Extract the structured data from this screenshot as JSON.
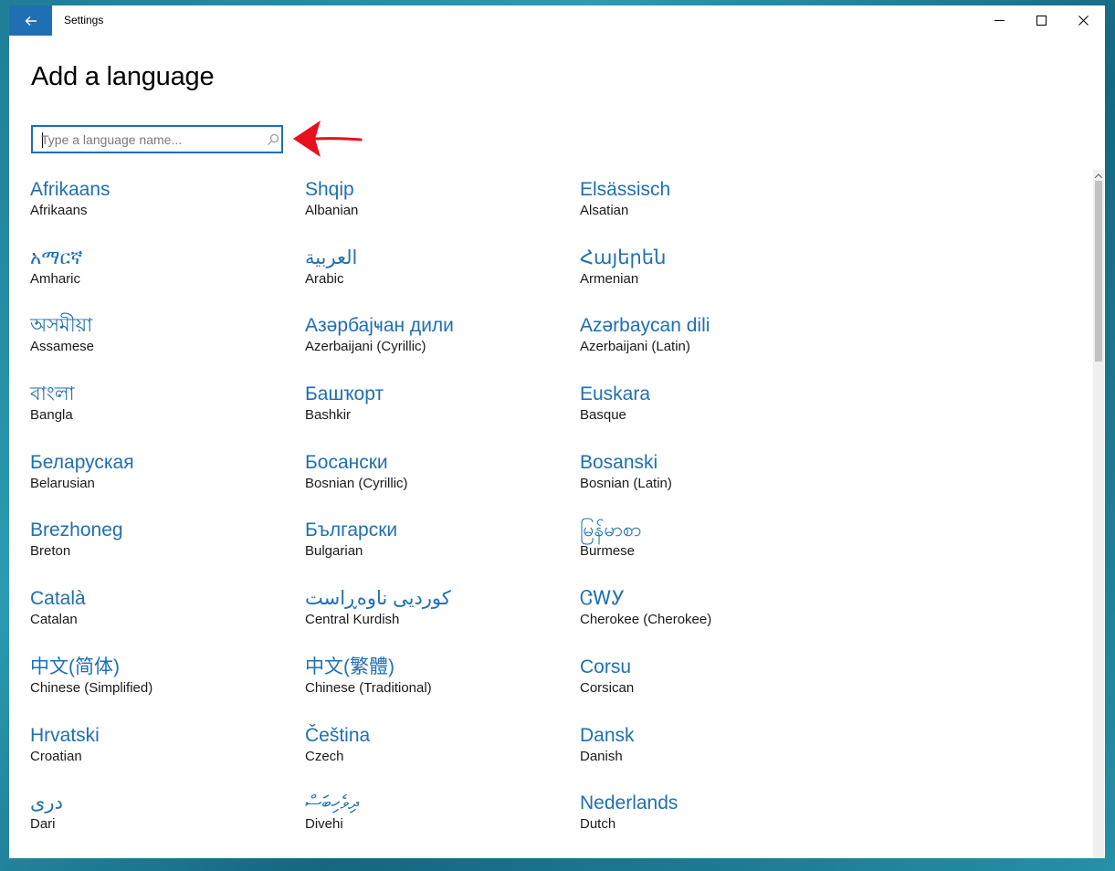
{
  "window": {
    "title": "Settings"
  },
  "page": {
    "title": "Add a language"
  },
  "search": {
    "placeholder": "Type a language name...",
    "value": ""
  },
  "languages": [
    [
      {
        "native": "Afrikaans",
        "english": "Afrikaans"
      },
      {
        "native": "Shqip",
        "english": "Albanian"
      },
      {
        "native": "Elsässisch",
        "english": "Alsatian"
      }
    ],
    [
      {
        "native": "አማርኛ",
        "english": "Amharic"
      },
      {
        "native": "العربية",
        "english": "Arabic"
      },
      {
        "native": "Հայերեն",
        "english": "Armenian"
      }
    ],
    [
      {
        "native": "অসমীয়া",
        "english": "Assamese"
      },
      {
        "native": "Азәрбајҹан дили",
        "english": "Azerbaijani (Cyrillic)"
      },
      {
        "native": "Azərbaycan dili",
        "english": "Azerbaijani (Latin)"
      }
    ],
    [
      {
        "native": "বাংলা",
        "english": "Bangla"
      },
      {
        "native": "Башҡорт",
        "english": "Bashkir"
      },
      {
        "native": "Euskara",
        "english": "Basque"
      }
    ],
    [
      {
        "native": "Беларуская",
        "english": "Belarusian"
      },
      {
        "native": "Босански",
        "english": "Bosnian (Cyrillic)"
      },
      {
        "native": "Bosanski",
        "english": "Bosnian (Latin)"
      }
    ],
    [
      {
        "native": "Brezhoneg",
        "english": "Breton"
      },
      {
        "native": "Български",
        "english": "Bulgarian"
      },
      {
        "native": "မြန်မာစာ",
        "english": "Burmese"
      }
    ],
    [
      {
        "native": "Català",
        "english": "Catalan"
      },
      {
        "native": "کوردیی ناوەڕاست",
        "english": "Central Kurdish"
      },
      {
        "native": "ᏣᎳᎩ",
        "english": "Cherokee (Cherokee)"
      }
    ],
    [
      {
        "native": "中文(简体)",
        "english": "Chinese (Simplified)"
      },
      {
        "native": "中文(繁體)",
        "english": "Chinese (Traditional)"
      },
      {
        "native": "Corsu",
        "english": "Corsican"
      }
    ],
    [
      {
        "native": "Hrvatski",
        "english": "Croatian"
      },
      {
        "native": "Čeština",
        "english": "Czech"
      },
      {
        "native": "Dansk",
        "english": "Danish"
      }
    ],
    [
      {
        "native": "درى",
        "english": "Dari"
      },
      {
        "native": "ދިވެހިބަސް",
        "english": "Divehi"
      },
      {
        "native": "Nederlands",
        "english": "Dutch"
      }
    ]
  ],
  "colors": {
    "accent": "#1e6fb3",
    "annotation": "#e8101c"
  },
  "icons": {
    "back": "back-arrow-icon",
    "minimize": "minimize-icon",
    "maximize": "maximize-icon",
    "close": "close-icon",
    "search": "search-icon"
  }
}
